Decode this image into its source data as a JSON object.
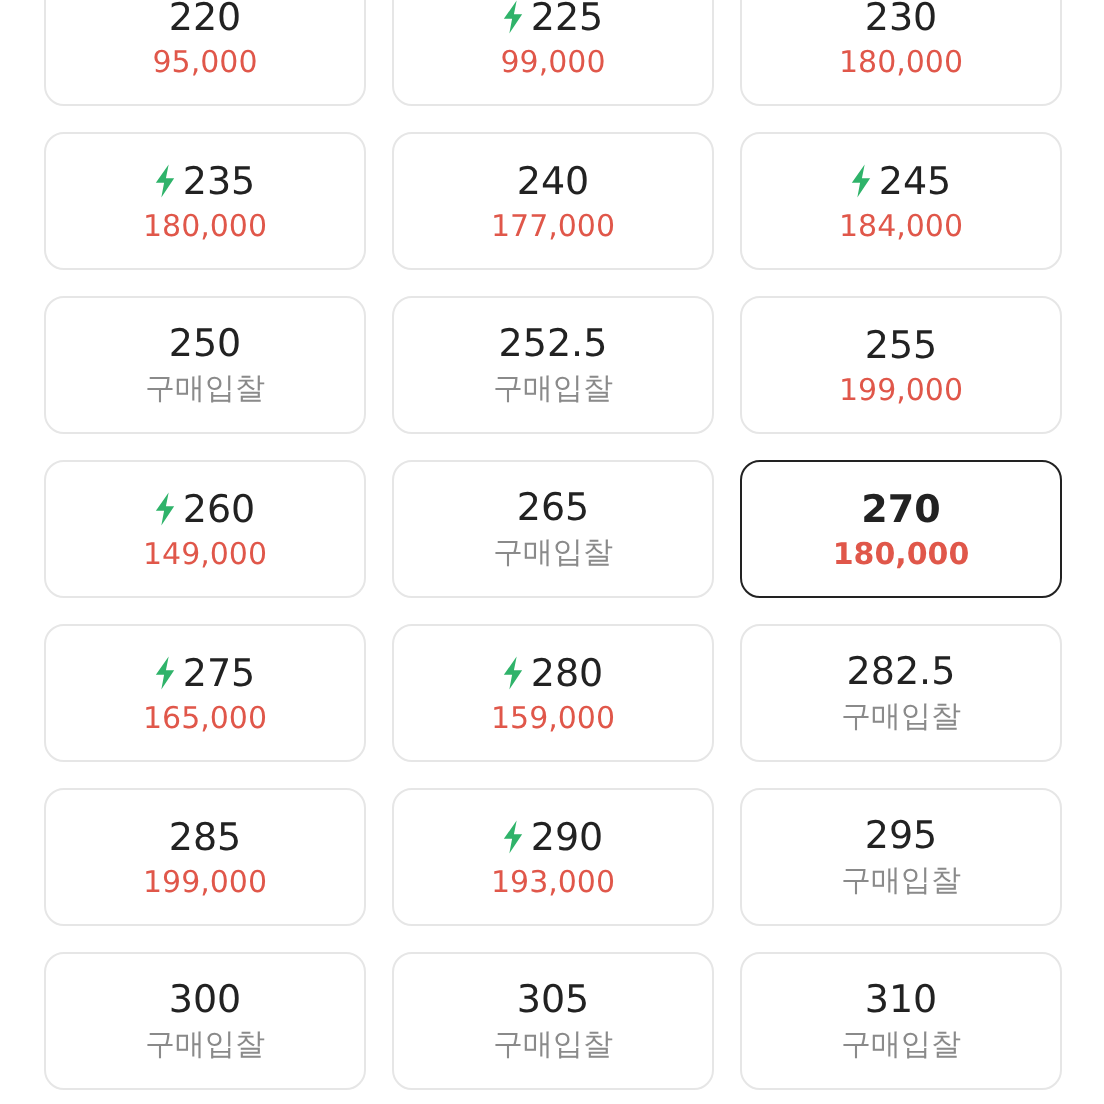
{
  "sizes": [
    {
      "size": "220",
      "price": "95,000",
      "kind": "price",
      "fast": false,
      "selected": false
    },
    {
      "size": "225",
      "price": "99,000",
      "kind": "price",
      "fast": true,
      "selected": false
    },
    {
      "size": "230",
      "price": "180,000",
      "kind": "price",
      "fast": false,
      "selected": false
    },
    {
      "size": "235",
      "price": "180,000",
      "kind": "price",
      "fast": true,
      "selected": false
    },
    {
      "size": "240",
      "price": "177,000",
      "kind": "price",
      "fast": false,
      "selected": false
    },
    {
      "size": "245",
      "price": "184,000",
      "kind": "price",
      "fast": true,
      "selected": false
    },
    {
      "size": "250",
      "price": "구매입찰",
      "kind": "bid",
      "fast": false,
      "selected": false
    },
    {
      "size": "252.5",
      "price": "구매입찰",
      "kind": "bid",
      "fast": false,
      "selected": false
    },
    {
      "size": "255",
      "price": "199,000",
      "kind": "price",
      "fast": false,
      "selected": false
    },
    {
      "size": "260",
      "price": "149,000",
      "kind": "price",
      "fast": true,
      "selected": false
    },
    {
      "size": "265",
      "price": "구매입찰",
      "kind": "bid",
      "fast": false,
      "selected": false
    },
    {
      "size": "270",
      "price": "180,000",
      "kind": "price",
      "fast": false,
      "selected": true
    },
    {
      "size": "275",
      "price": "165,000",
      "kind": "price",
      "fast": true,
      "selected": false
    },
    {
      "size": "280",
      "price": "159,000",
      "kind": "price",
      "fast": true,
      "selected": false
    },
    {
      "size": "282.5",
      "price": "구매입찰",
      "kind": "bid",
      "fast": false,
      "selected": false
    },
    {
      "size": "285",
      "price": "199,000",
      "kind": "price",
      "fast": false,
      "selected": false
    },
    {
      "size": "290",
      "price": "193,000",
      "kind": "price",
      "fast": true,
      "selected": false
    },
    {
      "size": "295",
      "price": "구매입찰",
      "kind": "bid",
      "fast": false,
      "selected": false
    },
    {
      "size": "300",
      "price": "구매입찰",
      "kind": "bid",
      "fast": false,
      "selected": false
    },
    {
      "size": "305",
      "price": "구매입찰",
      "kind": "bid",
      "fast": false,
      "selected": false
    },
    {
      "size": "310",
      "price": "구매입찰",
      "kind": "bid",
      "fast": false,
      "selected": false
    }
  ]
}
